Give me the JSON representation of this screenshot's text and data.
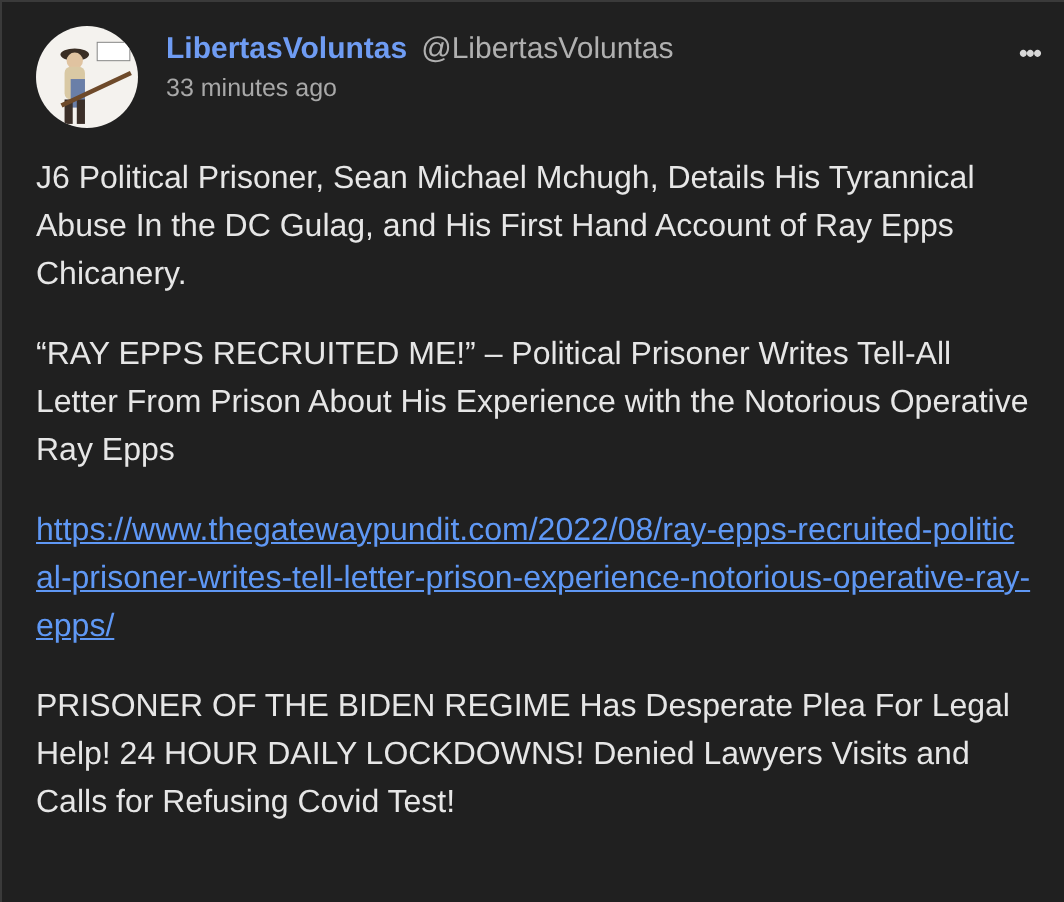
{
  "post": {
    "author": "LibertasVoluntas",
    "handle": "@LibertasVoluntas",
    "time": "33 minutes ago",
    "menu": "•••",
    "paragraphs": [
      {
        "kind": "text",
        "text": "J6 Political Prisoner, Sean Michael Mchugh, Details His Tyrannical Abuse In the DC Gulag, and His First Hand Account of Ray Epps Chicanery."
      },
      {
        "kind": "text",
        "text": "“RAY EPPS RECRUITED ME!” – Political Prisoner Writes Tell-All Letter From Prison About His Experience with the Notorious Operative Ray Epps"
      },
      {
        "kind": "link",
        "text": "https://www.thegatewaypundit.com/2022/08/ray-epps-recruited-political-prisoner-writes-tell-letter-prison-experience-notorious-operative-ray-epps/"
      },
      {
        "kind": "text",
        "text": "PRISONER OF THE BIDEN REGIME Has Desperate Plea For Legal Help! 24 HOUR DAILY LOCKDOWNS! Denied Lawyers Visits and Calls for Refusing Covid Test!"
      }
    ]
  }
}
